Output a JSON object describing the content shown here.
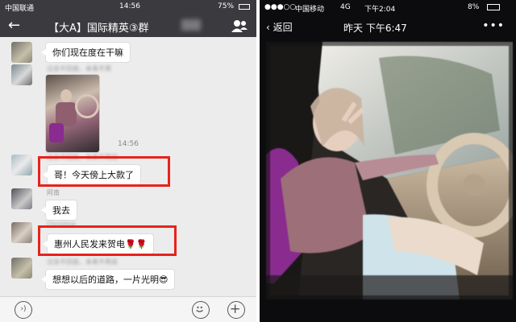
{
  "left": {
    "status": {
      "carrier": "中国联通",
      "time": "14:56",
      "battery": "75%"
    },
    "header": {
      "back_icon": "back-arrow-icon",
      "title": "【大A】国际精英③群",
      "member_icon": "group-icon"
    },
    "messages": [
      {
        "type": "text",
        "text": "你们现在度在干嘛"
      },
      {
        "type": "image",
        "sender": "过去不回首，未来不再"
      },
      {
        "type": "time",
        "text": "14:56"
      },
      {
        "type": "text",
        "sender": "过去不回首，未来不再就",
        "text": "哥！今天傍上大款了",
        "highlighted": true
      },
      {
        "type": "text",
        "sender": "阿南",
        "text": "我去"
      },
      {
        "type": "text",
        "sender": "Christine",
        "text": "惠州人民发来贺电🌹🌹",
        "highlighted": true
      },
      {
        "type": "text",
        "sender": "过去不回首，未来不再就",
        "text": "想想以后的道路，一片光明😎"
      }
    ],
    "input_bar": {
      "voice_icon": "voice-icon",
      "emoji_icon": "emoji-icon",
      "plus_icon": "plus-icon"
    }
  },
  "right": {
    "status": {
      "carrier": "中国移动",
      "network": "4G",
      "time": "下午2:04",
      "battery": "8%"
    },
    "header": {
      "back_label": "返回",
      "timestamp": "昨天 下午6:47",
      "more": "•••"
    },
    "colors": {
      "seat": "#8a2b8f",
      "blouse": "#9c6f79",
      "sky": "#e8e8e2"
    }
  }
}
